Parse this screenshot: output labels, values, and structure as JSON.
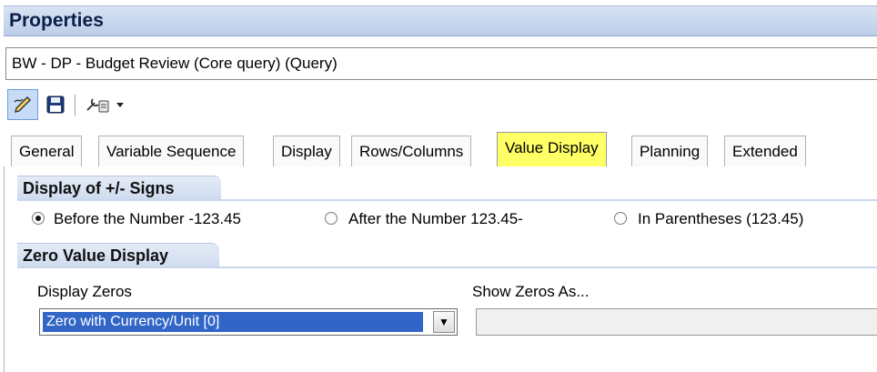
{
  "window": {
    "title": "Properties"
  },
  "query": {
    "name": "BW - DP - Budget Review (Core query) (Query)"
  },
  "toolbar": {
    "items": [
      "edit-query-icon",
      "save-icon",
      "tools-dropdown-icon"
    ]
  },
  "tabs": [
    {
      "label": "General"
    },
    {
      "label": "Variable Sequence"
    },
    {
      "label": "Display"
    },
    {
      "label": "Rows/Columns"
    },
    {
      "label": "Value Display",
      "active": true
    },
    {
      "label": "Planning"
    },
    {
      "label": "Extended"
    }
  ],
  "signs_group": {
    "title": "Display of +/- Signs",
    "options": [
      {
        "label": "Before the Number   -123.45",
        "selected": true
      },
      {
        "label": "After the Number  123.45-",
        "selected": false
      },
      {
        "label": "In Parentheses (123.45)",
        "selected": false
      }
    ]
  },
  "zero_group": {
    "title": "Zero Value Display",
    "display_zeros_label": "Display Zeros",
    "display_zeros_value": "Zero with Currency/Unit [0]",
    "show_zeros_as_label": "Show Zeros As...",
    "show_zeros_as_value": ""
  },
  "colors": {
    "active_tab": "#ffff66",
    "selection": "#3166c7",
    "group_header": "#d8e3f3"
  }
}
